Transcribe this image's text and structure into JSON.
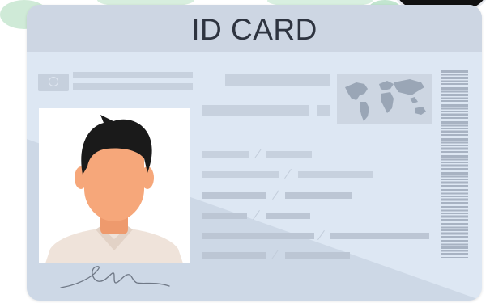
{
  "card": {
    "title": "ID CARD"
  },
  "icons": {
    "chip": "chip-icon",
    "world_map": "world-map-icon",
    "barcode": "barcode-icon",
    "avatar": "person-avatar-icon",
    "signature": "signature-icon"
  },
  "colors": {
    "card_background": "#dde7f3",
    "header_background": "#cdd6e3",
    "placeholder_bar": "#c7d1de",
    "title_text": "#2e3440",
    "skin": "#f6a77a",
    "hair": "#1a1a1a",
    "shirt": "#efe3da"
  }
}
